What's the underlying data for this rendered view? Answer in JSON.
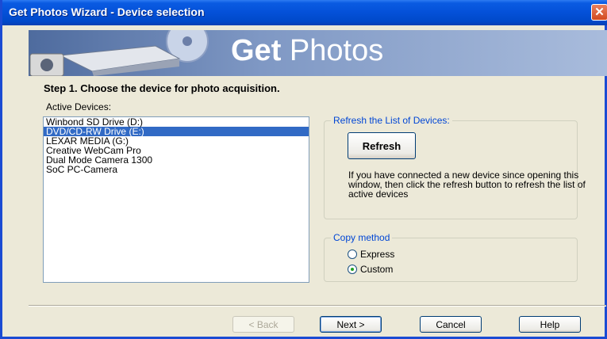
{
  "window": {
    "title": "Get Photos Wizard - Device selection"
  },
  "banner": {
    "title_bold": "Get",
    "title_rest": "Photos"
  },
  "instruction": "Step 1. Choose the device for photo acquisition.",
  "devices": {
    "label": "Active Devices:",
    "items": [
      "Winbond SD Drive (D:)",
      "DVD/CD-RW Drive (E:)",
      "LEXAR MEDIA (G:)",
      "Creative WebCam Pro",
      "Dual Mode Camera 1300",
      "SoC PC-Camera"
    ],
    "selected": "DVD/CD-RW Drive (E:)"
  },
  "refresh_group": {
    "legend": "Refresh the List of Devices:",
    "button": "Refresh",
    "help_text": "If you have connected a new device since opening this window, then click the refresh button to refresh the list of active devices"
  },
  "copy_method": {
    "legend": "Copy method",
    "options": [
      "Express",
      "Custom"
    ],
    "selected": "Custom"
  },
  "footer": {
    "back": "< Back",
    "next": "Next >",
    "cancel": "Cancel",
    "help": "Help"
  },
  "colors": {
    "title_bar": "#0450D8",
    "dialog_bg": "#ECE9D8",
    "selection": "#316AC5"
  }
}
